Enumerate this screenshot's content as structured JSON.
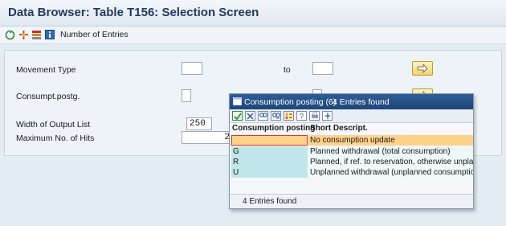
{
  "title": "Data Browser: Table T156: Selection Screen",
  "toolbar": {
    "icons": [
      "execute-icon",
      "fields-icon",
      "selection-options-icon",
      "info-icon"
    ],
    "number_of_entries": "Number of Entries"
  },
  "selection": {
    "movement_type_label": "Movement Type",
    "to_label": "to",
    "consumpt_label": "Consumpt.postg.",
    "width_label": "Width of Output List",
    "width_value": "250",
    "max_hits_label": "Maximum No. of Hits",
    "max_hits_value": "2"
  },
  "popup": {
    "title": "Consumption posting (6)",
    "entries_found_head": "4 Entries found",
    "col1": "Consumption posting",
    "col2": "Short Descript.",
    "rows": [
      {
        "code": "",
        "desc": "No consumption update"
      },
      {
        "code": "G",
        "desc": "Planned withdrawal (total consumption)"
      },
      {
        "code": "R",
        "desc": "Planned, if ref. to reservation, otherwise unplanned"
      },
      {
        "code": "U",
        "desc": "Unplanned withdrawal (unplanned consumption)"
      }
    ],
    "status": "4 Entries found"
  },
  "colors": {
    "title_bar": "#dfe8f1",
    "popup_header": "#1e4679",
    "selected_row": "#ffd28a",
    "code_cell": "#bfe6e8"
  }
}
